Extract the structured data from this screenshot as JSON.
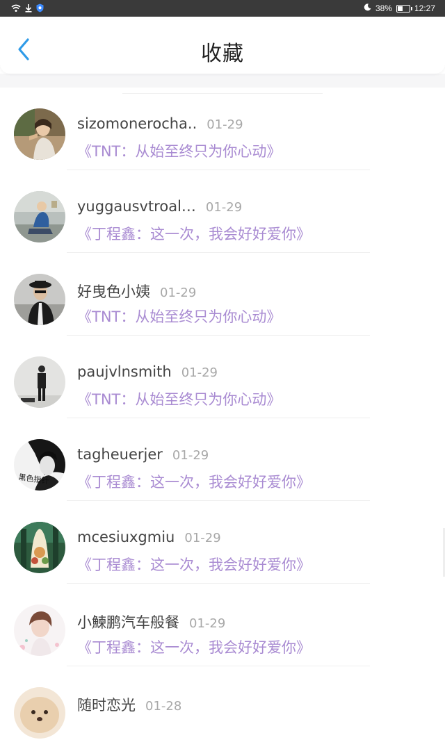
{
  "status_bar": {
    "battery": "38%",
    "battery_level": 0.38,
    "time": "12:27",
    "icons": [
      "wifi-icon",
      "download-icon",
      "shield-icon",
      "moon-icon",
      "battery-icon"
    ]
  },
  "header": {
    "title": "收藏",
    "back_icon": "chevron-left-icon",
    "accent_color": "#2f9be8"
  },
  "colors": {
    "collection_title": "#a98bd2",
    "date": "#a8a8a8",
    "name": "#444444"
  },
  "items": [
    {
      "name": "sizomonerocha..",
      "date": "01-29",
      "collection": "《TNT：从始至终只为你心动》"
    },
    {
      "name": "yuggausvtroal…",
      "date": "01-29",
      "collection": "《丁程鑫：这一次，我会好好爱你》"
    },
    {
      "name": "好曳色小姨",
      "date": "01-29",
      "collection": "《TNT：从始至终只为你心动》"
    },
    {
      "name": "paujvlnsmith",
      "date": "01-29",
      "collection": "《TNT：从始至终只为你心动》"
    },
    {
      "name": "tagheuerjer",
      "date": "01-29",
      "collection": "《丁程鑫：这一次，我会好好爱你》",
      "avatar_text": "黑色指针"
    },
    {
      "name": "mcesiuxgmiu",
      "date": "01-29",
      "collection": "《丁程鑫：这一次，我会好好爱你》"
    },
    {
      "name": "小鰊鹏汽车般餐",
      "date": "01-29",
      "collection": "《丁程鑫：这一次，我会好好爱你》"
    },
    {
      "name": "随时恋光",
      "date": "01-28",
      "collection": ""
    }
  ]
}
